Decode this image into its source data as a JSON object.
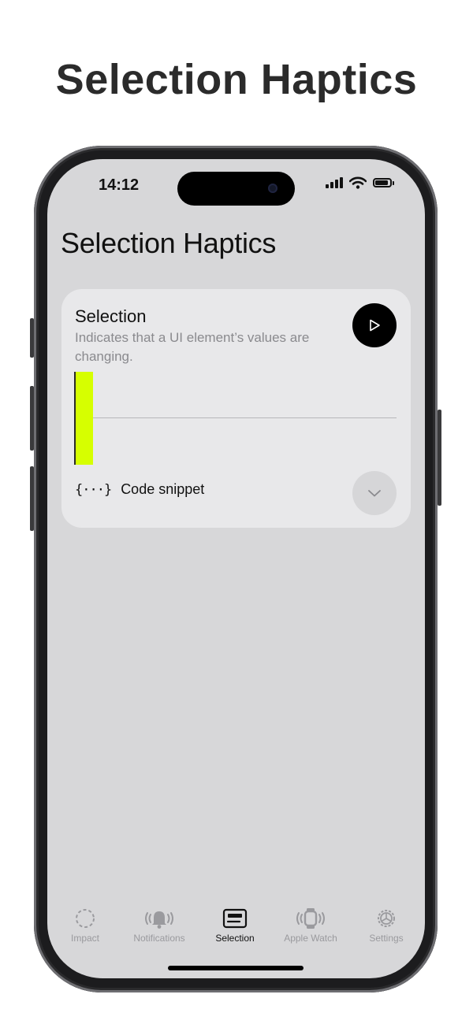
{
  "page": {
    "heading": "Selection Haptics"
  },
  "status_bar": {
    "time": "14:12",
    "icons": [
      "signal-icon",
      "wifi-icon",
      "battery-icon"
    ]
  },
  "nav": {
    "title": "Selection Haptics"
  },
  "card": {
    "title": "Selection",
    "description": "Indicates that a UI element’s values are changing.",
    "play_icon": "play-icon",
    "snippet_icon": "{···}",
    "snippet_label": "Code snippet",
    "expand_icon": "chevron-down-icon",
    "accent_color": "#d6ff00"
  },
  "tabbar": {
    "tabs": [
      {
        "label": "Impact",
        "icon": "impact-icon",
        "active": false
      },
      {
        "label": "Notifications",
        "icon": "bell-icon",
        "active": false
      },
      {
        "label": "Selection",
        "icon": "selection-icon",
        "active": true
      },
      {
        "label": "Apple Watch",
        "icon": "watch-icon",
        "active": false
      },
      {
        "label": "Settings",
        "icon": "gear-icon",
        "active": false
      }
    ]
  }
}
